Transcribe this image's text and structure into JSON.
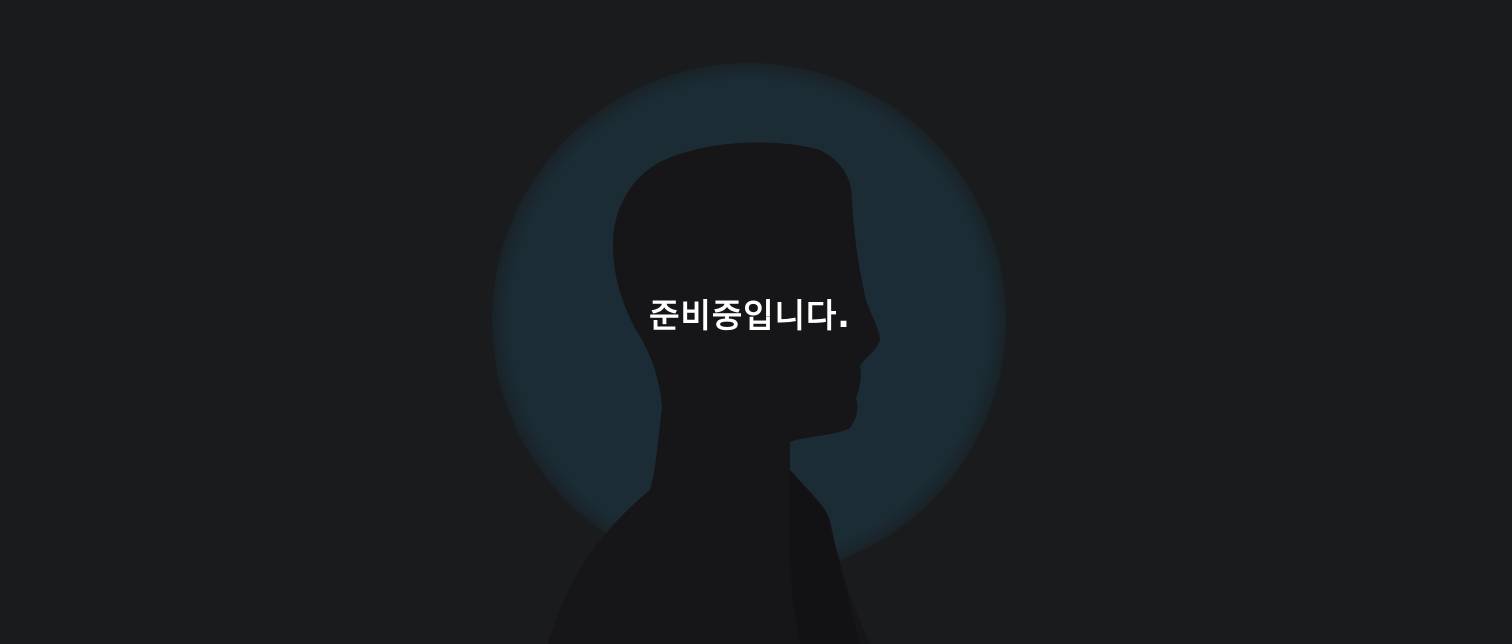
{
  "colors": {
    "page_background": "#1a1b1c",
    "halo": "#1b2c35",
    "silhouette": "#161518",
    "message_text": "#ffffff"
  },
  "hero": {
    "image": "silhouette-portrait",
    "message": "준비중입니다."
  }
}
